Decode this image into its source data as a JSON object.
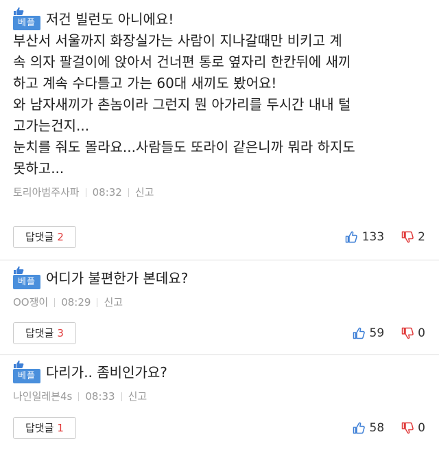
{
  "badge_label": "베플",
  "comments": [
    {
      "first_line": "저건 빌런도 아니에요!",
      "body": "부산서 서울까지 화장실가는 사람이 지나갈때만 비키고 계\n속 의자 팔걸이에 앉아서 건너편 통로 옆자리 한칸뒤에 새끼\n하고 계속 수다틀고 가는 60대 새끼도 봤어요!\n와 남자새끼가 촌놈이라 그런지 뭔 아가리를 두시간 내내 털\n고가는건지...\n눈치를 줘도 몰라요...사람들도 또라이 같은니까 뭐라 하지도\n못하고...",
      "author": "토리아범주사파",
      "time": "08:32",
      "report": "신고",
      "reply_label": "답댓글",
      "reply_count": "2",
      "likes": "133",
      "dislikes": "2"
    },
    {
      "first_line": "어디가 불편한가 본데요?",
      "body": "",
      "author": "OO쟁이",
      "time": "08:29",
      "report": "신고",
      "reply_label": "답댓글",
      "reply_count": "3",
      "likes": "59",
      "dislikes": "0"
    },
    {
      "first_line": "다리가.. 좀비인가요?",
      "body": "",
      "author": "나인일레븐4s",
      "time": "08:33",
      "report": "신고",
      "reply_label": "답댓글",
      "reply_count": "1",
      "likes": "58",
      "dislikes": "0"
    }
  ],
  "colors": {
    "badge": "#4a8fdc",
    "thumb_up": "#3d7fd6",
    "thumb_down": "#e03a3a",
    "reply_count": "#e03a3a"
  },
  "icons": [
    "thumbs-up-icon",
    "thumbs-down-icon",
    "best-thumb-icon"
  ]
}
